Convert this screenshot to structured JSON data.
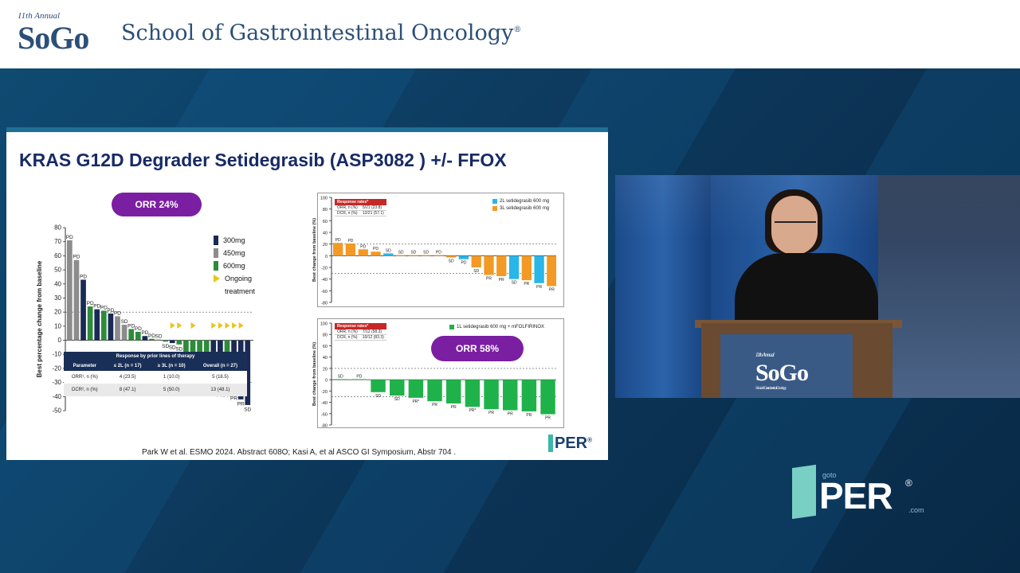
{
  "header": {
    "logo_annual": "11th Annual",
    "logo_brand": "SoGo",
    "title": "School of Gastrointestinal Oncology",
    "title_mark": "®"
  },
  "slide": {
    "title": "KRAS G12D Degrader Setidegrasib (ASP3082 ) +/- FFOX",
    "orr_pill_1": "ORR 24%",
    "orr_pill_2": "ORR 58%",
    "citation": "Park W et al. ESMO 2024. Abstract 608O; Kasi A, et al ASCO GI Symposium, Abstr 704 .",
    "sper_logo": "PER",
    "sper_mark": "®",
    "legend": {
      "l300": "300mg",
      "l450": "450mg",
      "l600": "600mg",
      "ongoing": "Ongoing",
      "treatment": "treatment"
    },
    "table": {
      "header_group": "Response by prior lines of therapy",
      "headers": [
        "Parameter",
        "≤ 2L (n = 17)",
        "≥ 3L (n = 10)",
        "Overall (n = 27)"
      ],
      "rows": [
        [
          "ORR¹, n (%)",
          "4 (23.5)",
          "1 (10.0)",
          "5 (18.5)"
        ],
        [
          "DCR², n (%)",
          "8 (47.1)",
          "5 (50.0)",
          "13 (48.1)"
        ]
      ]
    },
    "chart2_table": {
      "title": "Response rates*",
      "rows": [
        [
          "ORR, n (%)",
          "5/21 (23.8)"
        ],
        [
          "DCR, n (%)",
          "12/21 (57.1)"
        ]
      ]
    },
    "chart2_legend": {
      "a": "2L setidegrasib 600 mg",
      "b": "3L setidegrasib 600 mg"
    },
    "chart3_table": {
      "title": "Response rates*",
      "rows": [
        [
          "ORR, n (%)",
          "7/12 (58.3)"
        ],
        [
          "DCR, n (%)",
          "10/12 (83.3)"
        ]
      ]
    },
    "chart3_legend": {
      "a": "1L setidegrasib 600 mg + mFOLFIRINOX"
    }
  },
  "video": {
    "podium_annual": "11th Annual",
    "podium_brand": "SoGo",
    "podium_sub": "School of Gastrointestinal Oncology"
  },
  "goper": {
    "goto": "goto",
    "per": "PER",
    "reg": "®",
    "com": ".com"
  },
  "colors": {
    "c300": "#1a2a55",
    "c450": "#8c8c8c",
    "c600": "#2e8b3a",
    "ongoing": "#e6c619",
    "c2L": "#29b6e8",
    "c3L": "#f29a25",
    "c1L": "#20b24a"
  },
  "chart_data": [
    {
      "type": "bar",
      "ylabel": "Best percentage change from baseline",
      "ylim": [
        -50,
        80
      ],
      "yticks": [
        80,
        70,
        60,
        50,
        40,
        30,
        20,
        10,
        0,
        -10,
        -20,
        -30,
        -40,
        -50
      ],
      "legend_placement": "top-right",
      "bars": [
        {
          "value": 71,
          "dose": "450mg",
          "label": "PD"
        },
        {
          "value": 57,
          "dose": "450mg",
          "label": "PD"
        },
        {
          "value": 43,
          "dose": "300mg",
          "label": "PD"
        },
        {
          "value": 24,
          "dose": "600mg",
          "label": "PD"
        },
        {
          "value": 22,
          "dose": "300mg",
          "label": "PD"
        },
        {
          "value": 21,
          "dose": "600mg",
          "label": "PD"
        },
        {
          "value": 19,
          "dose": "300mg",
          "label": "PD"
        },
        {
          "value": 17,
          "dose": "450mg",
          "label": "PD"
        },
        {
          "value": 11,
          "dose": "450mg",
          "label": "SD"
        },
        {
          "value": 8,
          "dose": "600mg",
          "label": "PD"
        },
        {
          "value": 6,
          "dose": "600mg",
          "label": "PD"
        },
        {
          "value": 3,
          "dose": "300mg",
          "label": "PD"
        },
        {
          "value": 1,
          "dose": "600mg",
          "label": "PD"
        },
        {
          "value": 0.5,
          "dose": "450mg",
          "label": "SD"
        },
        {
          "value": -1,
          "dose": "600mg",
          "label": "SD"
        },
        {
          "value": -2,
          "dose": "300mg",
          "label": "SD",
          "ongoing": true
        },
        {
          "value": -3,
          "dose": "600mg",
          "label": "SD",
          "ongoing": true
        },
        {
          "value": -12,
          "dose": "600mg",
          "label": "SD"
        },
        {
          "value": -17,
          "dose": "600mg",
          "label": "SD",
          "ongoing": true
        },
        {
          "value": -22,
          "dose": "600mg",
          "label": "NE"
        },
        {
          "value": -27,
          "dose": "600mg",
          "label": "SD"
        },
        {
          "value": -35,
          "dose": "300mg",
          "label": "PR*",
          "ongoing": true
        },
        {
          "value": -36,
          "dose": "300mg",
          "label": "PR",
          "ongoing": true
        },
        {
          "value": -36,
          "dose": "600mg",
          "label": "PR",
          "ongoing": true
        },
        {
          "value": -38,
          "dose": "300mg",
          "label": "PR",
          "ongoing": true
        },
        {
          "value": -42,
          "dose": "300mg",
          "label": "PR",
          "ongoing": true
        },
        {
          "value": -46,
          "dose": "300mg",
          "label": "SD"
        }
      ],
      "reference_lines": [
        20,
        -30
      ]
    },
    {
      "type": "bar",
      "ylabel": "Best change from baseline (%)",
      "ylim": [
        -80,
        100
      ],
      "yticks": [
        100,
        80,
        60,
        40,
        20,
        0,
        -20,
        -40,
        -60,
        -80
      ],
      "series": [
        {
          "name": "2L setidegrasib 600 mg"
        },
        {
          "name": "3L setidegrasib 600 mg"
        }
      ],
      "bars": [
        {
          "value": 22,
          "line": "3L",
          "label": "PD"
        },
        {
          "value": 21,
          "line": "3L",
          "label": "PD"
        },
        {
          "value": 11,
          "line": "3L",
          "label": "PD"
        },
        {
          "value": 7,
          "line": "3L",
          "label": "PD"
        },
        {
          "value": 4,
          "line": "2L",
          "label": "SD"
        },
        {
          "value": 1,
          "line": "3L",
          "label": "SD"
        },
        {
          "value": 1,
          "line": "3L",
          "label": "SD"
        },
        {
          "value": 1,
          "line": "3L",
          "label": "SD"
        },
        {
          "value": 1,
          "line": "3L",
          "label": "PD"
        },
        {
          "value": -3,
          "line": "3L",
          "label": "SD"
        },
        {
          "value": -6,
          "line": "2L",
          "label": "PD"
        },
        {
          "value": -20,
          "line": "3L",
          "label": "SD"
        },
        {
          "value": -33,
          "line": "3L",
          "label": "PR"
        },
        {
          "value": -35,
          "line": "3L",
          "label": "PR"
        },
        {
          "value": -40,
          "line": "2L",
          "label": "SD"
        },
        {
          "value": -42,
          "line": "3L",
          "label": "PR"
        },
        {
          "value": -47,
          "line": "2L",
          "label": "PR"
        },
        {
          "value": -52,
          "line": "3L",
          "label": "PR"
        }
      ],
      "reference_lines": [
        20,
        -30
      ]
    },
    {
      "type": "bar",
      "ylabel": "Best change from baseline (%)",
      "ylim": [
        -80,
        100
      ],
      "yticks": [
        100,
        80,
        60,
        40,
        20,
        0,
        -20,
        -40,
        -60,
        -80
      ],
      "series": [
        {
          "name": "1L setidegrasib 600 mg + mFOLFIRINOX"
        }
      ],
      "bars": [
        {
          "value": 1,
          "label": "SD"
        },
        {
          "value": 1,
          "label": "PD"
        },
        {
          "value": -22,
          "label": "SD"
        },
        {
          "value": -28,
          "label": "SD"
        },
        {
          "value": -32,
          "label": "PR*"
        },
        {
          "value": -38,
          "label": "PR"
        },
        {
          "value": -42,
          "label": "PR"
        },
        {
          "value": -48,
          "label": "PR*"
        },
        {
          "value": -52,
          "label": "PR"
        },
        {
          "value": -54,
          "label": "PR"
        },
        {
          "value": -56,
          "label": "PR"
        },
        {
          "value": -61,
          "label": "PR"
        }
      ],
      "reference_lines": [
        20,
        -30
      ]
    }
  ]
}
